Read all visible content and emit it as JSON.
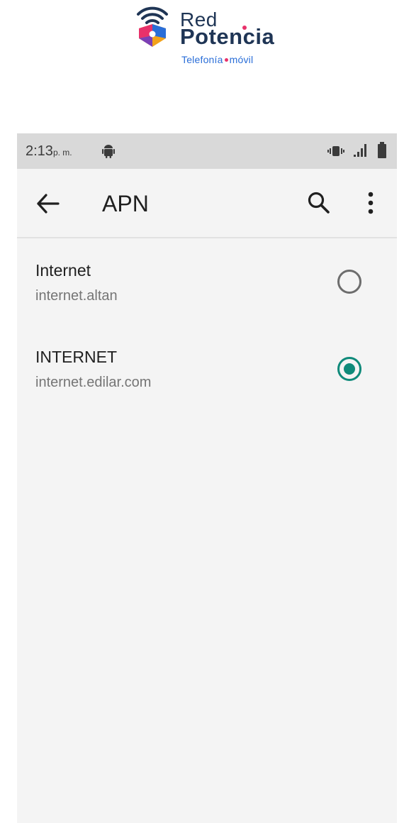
{
  "brand": {
    "line1": "Red",
    "line2": "Potencia",
    "tagline_left": "Telefonía",
    "tagline_right": "móvil",
    "colors": {
      "text": "#1f3555",
      "accent_pink": "#e8316a",
      "accent_blue": "#2a6ed8"
    }
  },
  "status_bar": {
    "time": "2:13",
    "period": "p. m.",
    "icons": [
      "android-icon",
      "vibrate-icon",
      "signal-icon",
      "battery-icon"
    ]
  },
  "app_bar": {
    "title": "APN",
    "icons": [
      "back-arrow-icon",
      "search-icon",
      "more-vert-icon"
    ]
  },
  "apn_list": [
    {
      "name": "Internet",
      "apn": "internet.altan",
      "selected": false
    },
    {
      "name": "INTERNET",
      "apn": "internet.edilar.com",
      "selected": true
    }
  ],
  "colors": {
    "radio_selected": "#0f8a7a",
    "radio_unselected": "#6d6d6d",
    "background": "#f4f4f4",
    "status_bar": "#d9d9d9"
  }
}
